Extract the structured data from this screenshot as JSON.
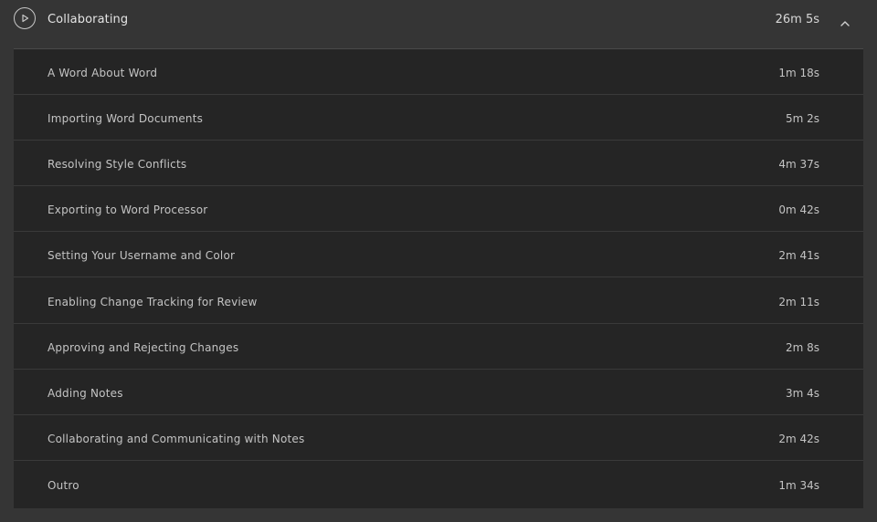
{
  "section": {
    "title": "Collaborating",
    "duration": "26m 5s",
    "play_icon": "play-circle-icon",
    "collapse_icon": "chevron-up-icon"
  },
  "lessons": [
    {
      "title": "A Word About Word",
      "duration": "1m 18s"
    },
    {
      "title": "Importing Word Documents",
      "duration": "5m 2s"
    },
    {
      "title": "Resolving Style Conflicts",
      "duration": "4m 37s"
    },
    {
      "title": "Exporting to Word Processor",
      "duration": "0m 42s"
    },
    {
      "title": "Setting Your Username and Color",
      "duration": "2m 41s"
    },
    {
      "title": "Enabling Change Tracking for Review",
      "duration": "2m 11s"
    },
    {
      "title": "Approving and Rejecting Changes",
      "duration": "2m 8s"
    },
    {
      "title": "Adding Notes",
      "duration": "3m 4s"
    },
    {
      "title": "Collaborating and Communicating with Notes",
      "duration": "2m 42s"
    },
    {
      "title": "Outro",
      "duration": "1m 34s"
    }
  ]
}
